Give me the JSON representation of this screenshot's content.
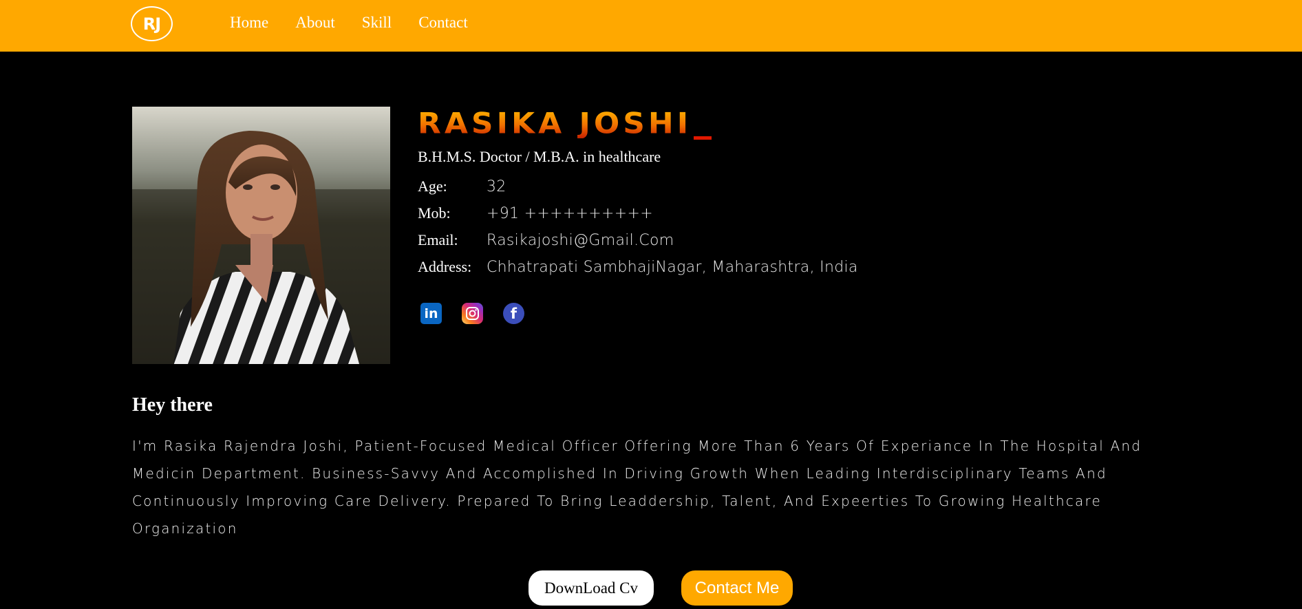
{
  "header": {
    "logo_text": "RJ",
    "nav": [
      {
        "label": "Home"
      },
      {
        "label": "About"
      },
      {
        "label": "Skill"
      },
      {
        "label": "Contact"
      }
    ]
  },
  "profile": {
    "name": "Rasika Joshi",
    "subtitle": "B.H.M.S. Doctor / M.B.A. in healthcare",
    "details": [
      {
        "label": "Age:",
        "value": "32"
      },
      {
        "label": "Mob:",
        "value": "+91 ++++++++++"
      },
      {
        "label": "Email:",
        "value": "Rasikajoshi@Gmail.Com"
      },
      {
        "label": "Address:",
        "value": "Chhatrapati SambhajiNagar, Maharashtra, India"
      }
    ],
    "socials": [
      {
        "name": "linkedin-icon",
        "glyph": "in"
      },
      {
        "name": "instagram-icon",
        "glyph": ""
      },
      {
        "name": "facebook-icon",
        "glyph": "f"
      }
    ]
  },
  "about": {
    "heading": "Hey there",
    "text": "I'm Rasika Rajendra Joshi, Patient-Focused Medical Officer Offering More Than 6 Years Of Experiance In The Hospital And Medicin Department. Business-Savvy And Accomplished In Driving Growth When Leading Interdisciplinary Teams And Continuously Improving Care Delivery. Prepared To Bring Leaddership, Talent, And Expeerties To Growing Healthcare Organization"
  },
  "buttons": {
    "download_label": "DownLoad Cv",
    "contact_label": "Contact Me"
  },
  "colors": {
    "accent": "#FFA800",
    "background": "#000000",
    "name_gradient_top": "#FFB300",
    "name_gradient_bottom": "#C82000"
  }
}
